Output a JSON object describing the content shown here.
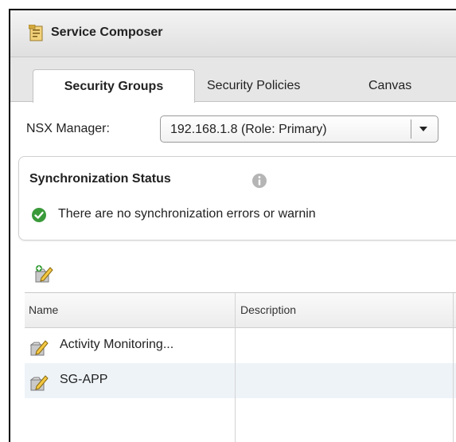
{
  "window": {
    "title": "Service Composer",
    "icon": "service-composer-icon"
  },
  "tabs": [
    {
      "label": "Security Groups",
      "active": true
    },
    {
      "label": "Security Policies",
      "active": false
    },
    {
      "label": "Canvas",
      "active": false
    }
  ],
  "nsx_manager": {
    "label": "NSX Manager:",
    "selected": "192.168.1.8 (Role: Primary)"
  },
  "sync_status": {
    "title": "Synchronization Status",
    "message": "There are no synchronization errors or warnin"
  },
  "toolbar": {
    "add_icon": "add-security-group-icon"
  },
  "table": {
    "columns": [
      "Name",
      "Description"
    ],
    "rows": [
      {
        "name": "Activity Monitoring...",
        "description": ""
      },
      {
        "name": "SG-APP",
        "description": ""
      }
    ]
  },
  "colors": {
    "active_tab": "#ffffff",
    "tab_bar": "#e6e6e6",
    "selected_row": "#eef3f8",
    "ok_green": "#3a9a3a",
    "info_gray": "#b5b5b5"
  }
}
